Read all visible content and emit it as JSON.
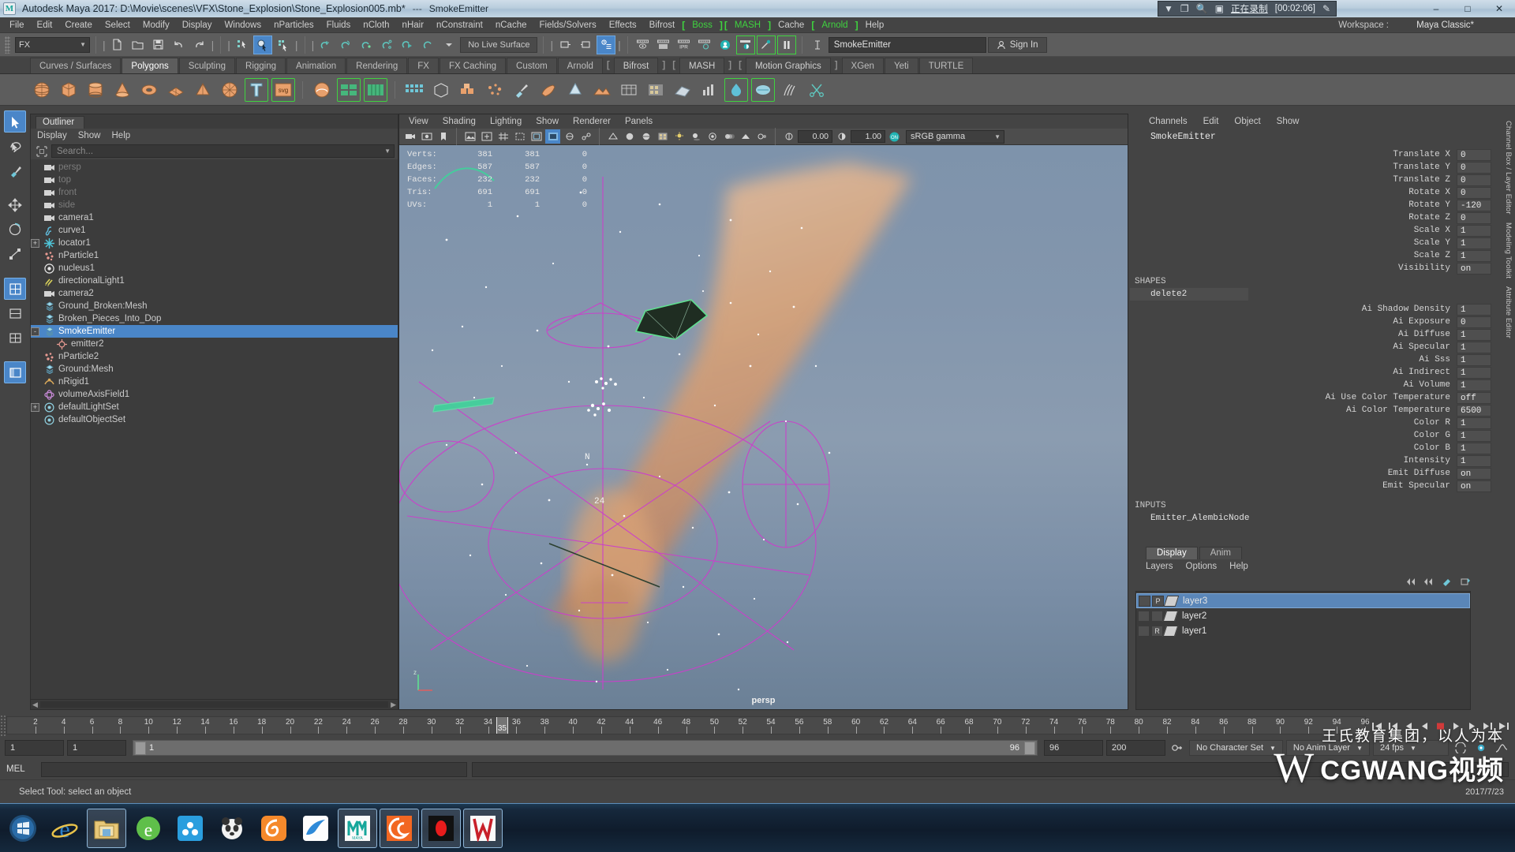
{
  "titlebar": {
    "app_icon": "maya-icon",
    "title": "Autodesk Maya 2017: D:\\Movie\\scenes\\VFX\\Stone_Explosion\\Stone_Explosion005.mb*",
    "separator": "---",
    "object": "SmokeEmitter",
    "minimize": "–",
    "maximize": "□",
    "close": "✕"
  },
  "recording": {
    "dropdown_icon": "chevron-down-icon",
    "window_icon": "window-icon",
    "zoom_icon": "magnifier-icon",
    "region_icon": "region-select-icon",
    "status": "正在录制",
    "timer": "[00:02:06]",
    "pen_icon": "pencil-icon"
  },
  "menubar": {
    "items": [
      {
        "label": "File",
        "bracketed": false
      },
      {
        "label": "Edit",
        "bracketed": false
      },
      {
        "label": "Create",
        "bracketed": false
      },
      {
        "label": "Select",
        "bracketed": false
      },
      {
        "label": "Modify",
        "bracketed": false
      },
      {
        "label": "Display",
        "bracketed": false
      },
      {
        "label": "Windows",
        "bracketed": false
      },
      {
        "label": "nParticles",
        "bracketed": false
      },
      {
        "label": "Fluids",
        "bracketed": false
      },
      {
        "label": "nCloth",
        "bracketed": false
      },
      {
        "label": "nHair",
        "bracketed": false
      },
      {
        "label": "nConstraint",
        "bracketed": false
      },
      {
        "label": "nCache",
        "bracketed": false
      },
      {
        "label": "Fields/Solvers",
        "bracketed": false
      },
      {
        "label": "Effects",
        "bracketed": false
      },
      {
        "label": "Bifrost",
        "bracketed": false
      },
      {
        "label": "Boss",
        "bracketed": true
      },
      {
        "label": "MASH",
        "bracketed": true
      },
      {
        "label": "Cache",
        "bracketed": false
      },
      {
        "label": "Arnold",
        "bracketed": true
      },
      {
        "label": "Help",
        "bracketed": false
      }
    ],
    "workspace_label": "Workspace :",
    "workspace_value": "Maya Classic*"
  },
  "statusline": {
    "mode_menu": "FX",
    "no_live_surface": "No Live Surface",
    "object_name": "SmokeEmitter",
    "sign_in": "Sign In"
  },
  "shelf": {
    "tabs": [
      {
        "label": "Curves / Surfaces",
        "active": false,
        "green": false
      },
      {
        "label": "Polygons",
        "active": true,
        "green": false
      },
      {
        "label": "Sculpting",
        "active": false,
        "green": false
      },
      {
        "label": "Rigging",
        "active": false,
        "green": false
      },
      {
        "label": "Animation",
        "active": false,
        "green": false
      },
      {
        "label": "Rendering",
        "active": false,
        "green": false
      },
      {
        "label": "FX",
        "active": false,
        "green": false
      },
      {
        "label": "FX Caching",
        "active": false,
        "green": false
      },
      {
        "label": "Custom",
        "active": false,
        "green": false
      },
      {
        "label": "Arnold",
        "active": false,
        "green": false
      },
      {
        "label": "Bifrost",
        "active": false,
        "green": true
      },
      {
        "label": "MASH",
        "active": false,
        "green": true
      },
      {
        "label": "Motion Graphics",
        "active": false,
        "green": true
      },
      {
        "label": "XGen",
        "active": false,
        "green": false
      },
      {
        "label": "Yeti",
        "active": false,
        "green": false
      },
      {
        "label": "TURTLE",
        "active": false,
        "green": false
      }
    ]
  },
  "outliner": {
    "tab": "Outliner",
    "menus": [
      "Display",
      "Show",
      "Help"
    ],
    "search_placeholder": "Search...",
    "items": [
      {
        "label": "persp",
        "icon": "camera-icon",
        "indent": 1,
        "dim": true,
        "selected": false,
        "expand": ""
      },
      {
        "label": "top",
        "icon": "camera-icon",
        "indent": 1,
        "dim": true,
        "selected": false,
        "expand": ""
      },
      {
        "label": "front",
        "icon": "camera-icon",
        "indent": 1,
        "dim": true,
        "selected": false,
        "expand": ""
      },
      {
        "label": "side",
        "icon": "camera-icon",
        "indent": 1,
        "dim": true,
        "selected": false,
        "expand": ""
      },
      {
        "label": "camera1",
        "icon": "camera-icon",
        "indent": 1,
        "dim": false,
        "selected": false,
        "expand": ""
      },
      {
        "label": "curve1",
        "icon": "curve-icon",
        "indent": 1,
        "dim": false,
        "selected": false,
        "expand": ""
      },
      {
        "label": "locator1",
        "icon": "locator-icon",
        "indent": 1,
        "dim": false,
        "selected": false,
        "expand": "+"
      },
      {
        "label": "nParticle1",
        "icon": "particle-icon",
        "indent": 1,
        "dim": false,
        "selected": false,
        "expand": ""
      },
      {
        "label": "nucleus1",
        "icon": "nucleus-icon",
        "indent": 1,
        "dim": false,
        "selected": false,
        "expand": ""
      },
      {
        "label": "directionalLight1",
        "icon": "light-icon",
        "indent": 1,
        "dim": false,
        "selected": false,
        "expand": ""
      },
      {
        "label": "camera2",
        "icon": "camera-icon",
        "indent": 1,
        "dim": false,
        "selected": false,
        "expand": ""
      },
      {
        "label": "Ground_Broken:Mesh",
        "icon": "mesh-icon",
        "indent": 1,
        "dim": false,
        "selected": false,
        "expand": ""
      },
      {
        "label": "Broken_Pieces_Into_Dop",
        "icon": "mesh-icon",
        "indent": 1,
        "dim": false,
        "selected": false,
        "expand": ""
      },
      {
        "label": "SmokeEmitter",
        "icon": "mesh-icon",
        "indent": 1,
        "dim": false,
        "selected": true,
        "expand": "-"
      },
      {
        "label": "emitter2",
        "icon": "emitter-icon",
        "indent": 2,
        "dim": false,
        "selected": false,
        "expand": ""
      },
      {
        "label": "nParticle2",
        "icon": "particle-icon",
        "indent": 1,
        "dim": false,
        "selected": false,
        "expand": ""
      },
      {
        "label": "Ground:Mesh",
        "icon": "mesh-icon",
        "indent": 1,
        "dim": false,
        "selected": false,
        "expand": ""
      },
      {
        "label": "nRigid1",
        "icon": "nrigid-icon",
        "indent": 1,
        "dim": false,
        "selected": false,
        "expand": ""
      },
      {
        "label": "volumeAxisField1",
        "icon": "field-icon",
        "indent": 1,
        "dim": false,
        "selected": false,
        "expand": ""
      },
      {
        "label": "defaultLightSet",
        "icon": "set-icon",
        "indent": 1,
        "dim": false,
        "selected": false,
        "expand": "+"
      },
      {
        "label": "defaultObjectSet",
        "icon": "set-icon",
        "indent": 1,
        "dim": false,
        "selected": false,
        "expand": ""
      }
    ]
  },
  "viewport": {
    "menus": [
      "View",
      "Shading",
      "Lighting",
      "Show",
      "Renderer",
      "Panels"
    ],
    "exposure_value": "0.00",
    "gamma_value": "1.00",
    "color_space": "sRGB gamma",
    "hud": {
      "rows": [
        {
          "label": "Verts:",
          "a": "381",
          "b": "381",
          "c": "0"
        },
        {
          "label": "Edges:",
          "a": "587",
          "b": "587",
          "c": "0"
        },
        {
          "label": "Faces:",
          "a": "232",
          "b": "232",
          "c": "0"
        },
        {
          "label": "Tris:",
          "a": "691",
          "b": "691",
          "c": "0"
        },
        {
          "label": "UVs:",
          "a": "1",
          "b": "1",
          "c": "0"
        }
      ]
    },
    "camera_label": "persp",
    "manip_letter": "N",
    "manip_number": "24",
    "axis_label": "z"
  },
  "channelbox": {
    "menus": [
      "Channels",
      "Edit",
      "Object",
      "Show"
    ],
    "object_name": "SmokeEmitter",
    "transform_rows": [
      {
        "name": "Translate X",
        "value": "0"
      },
      {
        "name": "Translate Y",
        "value": "0"
      },
      {
        "name": "Translate Z",
        "value": "0"
      },
      {
        "name": "Rotate X",
        "value": "0"
      },
      {
        "name": "Rotate Y",
        "value": "-120"
      },
      {
        "name": "Rotate Z",
        "value": "0"
      },
      {
        "name": "Scale X",
        "value": "1"
      },
      {
        "name": "Scale Y",
        "value": "1"
      },
      {
        "name": "Scale Z",
        "value": "1"
      },
      {
        "name": "Visibility",
        "value": "on"
      }
    ],
    "shapes_label": "SHAPES",
    "shape_name": "delete2",
    "shape_rows": [
      {
        "name": "Ai Shadow Density",
        "value": "1"
      },
      {
        "name": "Ai Exposure",
        "value": "0"
      },
      {
        "name": "Ai Diffuse",
        "value": "1"
      },
      {
        "name": "Ai Specular",
        "value": "1"
      },
      {
        "name": "Ai Sss",
        "value": "1"
      },
      {
        "name": "Ai Indirect",
        "value": "1"
      },
      {
        "name": "Ai Volume",
        "value": "1"
      },
      {
        "name": "Ai Use Color Temperature",
        "value": "off"
      },
      {
        "name": "Ai Color Temperature",
        "value": "6500"
      },
      {
        "name": "Color R",
        "value": "1"
      },
      {
        "name": "Color G",
        "value": "1"
      },
      {
        "name": "Color B",
        "value": "1"
      },
      {
        "name": "Intensity",
        "value": "1"
      },
      {
        "name": "Emit Diffuse",
        "value": "on"
      },
      {
        "name": "Emit Specular",
        "value": "on"
      }
    ],
    "inputs_label": "INPUTS",
    "input_node": "Emitter_AlembicNode"
  },
  "layereditor": {
    "tabs": [
      {
        "label": "Display",
        "active": true
      },
      {
        "label": "Anim",
        "active": false
      }
    ],
    "menus": [
      "Layers",
      "Options",
      "Help"
    ],
    "layers": [
      {
        "name": "layer3",
        "v": "",
        "p": "P",
        "selected": true
      },
      {
        "name": "layer2",
        "v": "",
        "p": "",
        "selected": false
      },
      {
        "name": "layer1",
        "v": "",
        "p": "R",
        "selected": false
      }
    ]
  },
  "sidetabs": [
    "Channel Box / Layer Editor",
    "Modeling Toolkit",
    "Attribute Editor"
  ],
  "timeslider": {
    "ticks": [
      2,
      4,
      6,
      8,
      10,
      12,
      14,
      16,
      18,
      20,
      22,
      24,
      26,
      28,
      30,
      32,
      34,
      36,
      38,
      40,
      42,
      44,
      46,
      48,
      50,
      52,
      54,
      56,
      58,
      60,
      62,
      64,
      66,
      68,
      70,
      72,
      74,
      76,
      78,
      80,
      82,
      84,
      86,
      88,
      90,
      92,
      94,
      96
    ],
    "current_frame": "35",
    "range_start": 1,
    "range_end": 96
  },
  "rangeslider": {
    "start_field": "1",
    "anim_start_field": "1",
    "bar_start": "1",
    "bar_end": "96",
    "end_field": "96",
    "anim_end_field": "200",
    "character_set": "No Character Set",
    "anim_layer": "No Anim Layer",
    "fps": "24 fps"
  },
  "mel": {
    "label": "MEL",
    "command_value": "",
    "output_value": ""
  },
  "status": {
    "message": "Select Tool: select an object"
  },
  "watermark": {
    "tagline": "王氏教育集团，以人为本",
    "brand": "CGWANG视频",
    "logo": "W",
    "date": "2017/7/23"
  },
  "taskbar": {
    "items": [
      {
        "name": "start-button",
        "framed": false
      },
      {
        "name": "internet-explorer-icon",
        "framed": false
      },
      {
        "name": "file-explorer-icon",
        "framed": true
      },
      {
        "name": "green-browser-icon",
        "framed": false
      },
      {
        "name": "cloud-sync-icon",
        "framed": false
      },
      {
        "name": "panda-app-icon",
        "framed": false
      },
      {
        "name": "uc-browser-icon",
        "framed": false
      },
      {
        "name": "foxmail-icon",
        "framed": false
      },
      {
        "name": "maya-taskbar-icon",
        "framed": true
      },
      {
        "name": "houdini-icon",
        "framed": true
      },
      {
        "name": "record-app-icon",
        "framed": true
      },
      {
        "name": "wang-app-icon",
        "framed": true
      }
    ]
  },
  "colors": {
    "accent_blue": "#4a86c8",
    "green_bracket": "#3fd33f",
    "panel_bg": "#444444",
    "toolbar_bg": "#5d5d5d",
    "viewport_sky": "#8396ad",
    "smoke": "#d8a078",
    "magenta_wire": "#c83cc8"
  }
}
